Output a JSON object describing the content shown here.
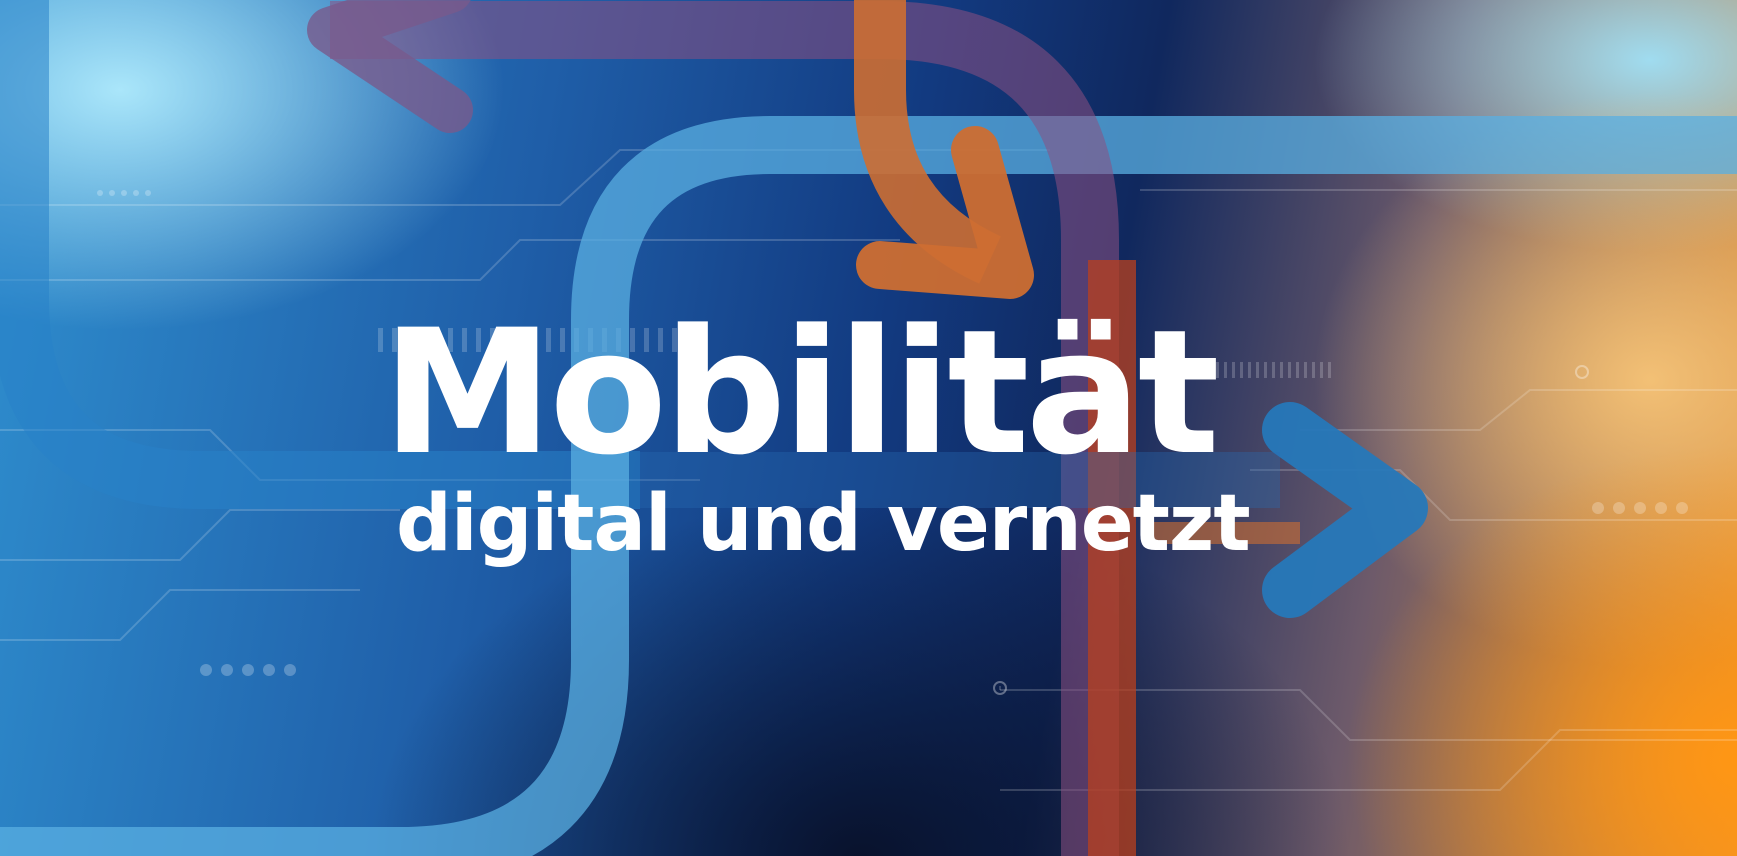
{
  "title": "Mobilität",
  "subtitle": "digital und vernetzt",
  "colors": {
    "text": "#ffffff",
    "blue_light": "#aee4f6",
    "blue_mid": "#2f8fcf",
    "blue_dark": "#10285e",
    "orange": "#f59a1c",
    "arrow_orange": "#c96a2e",
    "arrow_blue": "#2a79b8",
    "line_red": "#b5401e"
  },
  "decorations": {
    "arrow_top_left": "left-arrow-icon",
    "arrow_top_center": "down-arrow-icon",
    "arrow_right": "right-arrow-icon"
  }
}
